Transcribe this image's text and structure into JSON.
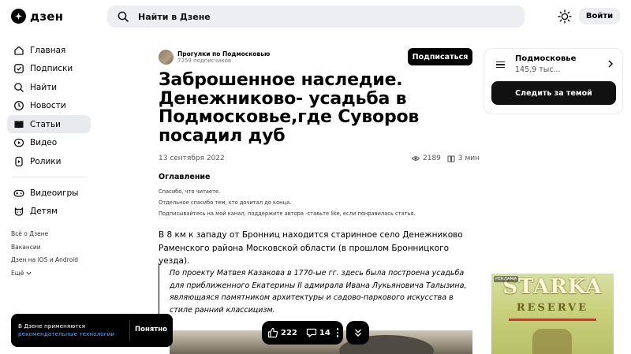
{
  "header": {
    "logo_text": "дзен",
    "search_placeholder": "Найти в Дзене",
    "login_label": "Войти"
  },
  "sidebar": {
    "items": [
      {
        "label": "Главная",
        "icon": "home-icon"
      },
      {
        "label": "Подписки",
        "icon": "subscriptions-icon"
      },
      {
        "label": "Найти",
        "icon": "search-icon"
      },
      {
        "label": "Новости",
        "icon": "news-icon"
      },
      {
        "label": "Статьи",
        "icon": "articles-icon",
        "active": true
      },
      {
        "label": "Видео",
        "icon": "video-icon"
      },
      {
        "label": "Ролики",
        "icon": "shorts-icon"
      }
    ],
    "items2": [
      {
        "label": "Видеоигры",
        "icon": "gamepad-icon"
      },
      {
        "label": "Детям",
        "icon": "kids-icon"
      }
    ],
    "footer": [
      "Всё о Дзене",
      "Вакансии",
      "Дзен на iOS и Android",
      "Ещё"
    ]
  },
  "article": {
    "channel_name": "Прогулки по Подмосковью",
    "channel_subs": "7259 подписчиков",
    "subscribe_label": "Подписаться",
    "title": "Заброшенное наследие. Денежниково- усадьба в Подмосковье,где Суворов посадил дуб",
    "date": "13 сентября 2022",
    "views": "2189",
    "read_time": "3 мин",
    "toc_title": "Оглавление",
    "toc": [
      "Спасибо, что читаете.",
      "Отдельное спасибо тем, кто дочитал до конца.",
      "Подписывайтесь на мой канал; поддержите автора -ставьте like, если понравилась статья."
    ],
    "lead": "В 8 км к западу от Бронниц находится старинное село Денежниково Раменского района Московской области (в прошлом Бронницкого уезда).",
    "quote": "По проекту Матвея Казакова в 1770-ые гг. здесь была построена усадьба для приближенного Екатерины II адмирала Ивана Лукьяновича Талызина, являющаяся памятником архитектуры и садово-паркового искусства в стиле ранний классицизм."
  },
  "topic": {
    "name": "Подмосковье",
    "count": "145,9 тыс...",
    "follow_label": "Следить за темой"
  },
  "ad": {
    "badge": "РЕКЛАМА",
    "brand": "STARKA",
    "sub": "RESERVE"
  },
  "toast": {
    "text": "В Дзене применяются",
    "link": "рекомендательные технологии",
    "button": "Понятно"
  },
  "reactions": {
    "likes": "222",
    "comments": "14"
  }
}
